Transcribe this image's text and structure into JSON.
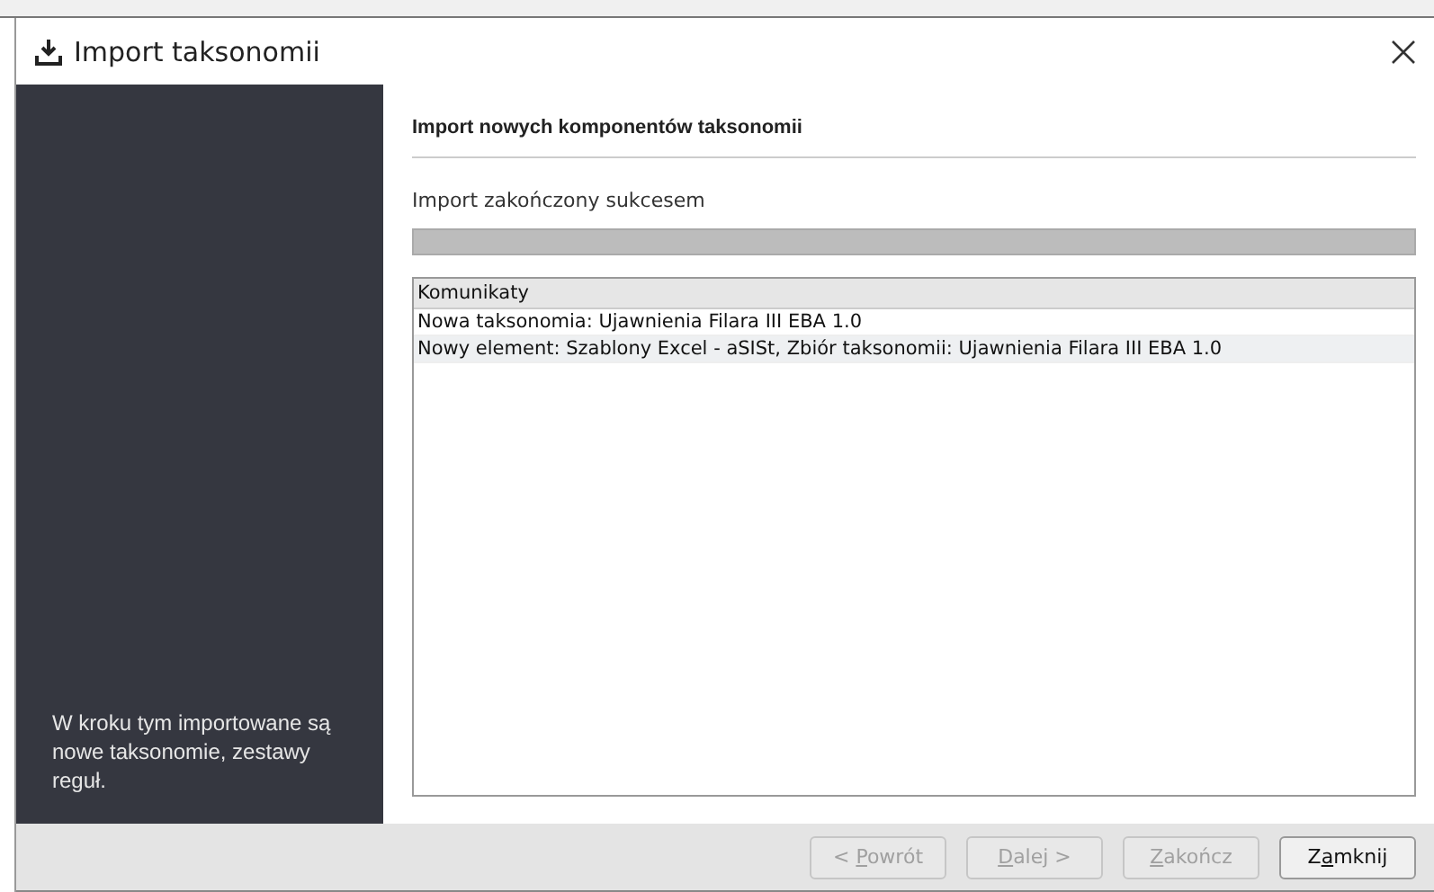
{
  "window": {
    "title": "Import taksonomii"
  },
  "sidebar": {
    "description": "W kroku tym importowane są nowe taksonomie, zestawy reguł."
  },
  "content": {
    "heading": "Import nowych komponentów taksonomii",
    "status": "Import zakończony sukcesem",
    "progress": {
      "level": 1
    }
  },
  "table": {
    "columns": [
      "Komunikaty"
    ],
    "rows": [
      {
        "text": "Nowa taksonomia:  Ujawnienia Filara III EBA 1.0",
        "selected": false
      },
      {
        "text": "Nowy element: Szablony Excel - aSISt, Zbiór taksonomii: Ujawnienia Filara III EBA 1.0",
        "selected": true
      }
    ]
  },
  "buttons": [
    {
      "before": "< ",
      "key": "P",
      "after": "owrót",
      "disabled": true
    },
    {
      "key": "D",
      "after": "alej >",
      "disabled": true
    },
    {
      "key": "Z",
      "after": "akończ",
      "disabled": true
    },
    {
      "before": "Z",
      "key": "a",
      "after": "mknij",
      "disabled": false
    }
  ]
}
